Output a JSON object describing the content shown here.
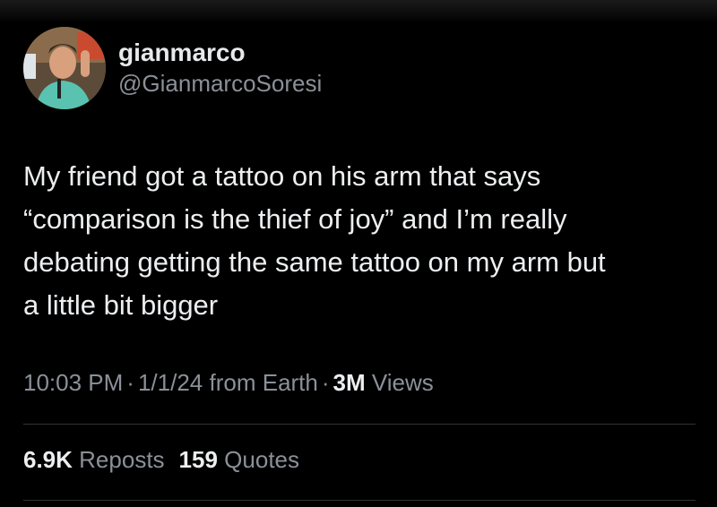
{
  "author": {
    "display_name": "gianmarco",
    "handle": "@GianmarcoSoresi",
    "avatar_icon": "profile-photo"
  },
  "tweet": {
    "text_lines": [
      "My friend got a tattoo on his arm that says",
      "“comparison is the thief of joy” and I’m really",
      "debating getting the same tattoo on my arm but",
      "a little bit bigger"
    ]
  },
  "meta": {
    "time": "10:03 PM",
    "separator": "·",
    "date": "1/1/24",
    "location": "from Earth",
    "views_count": "3M",
    "views_label": "Views"
  },
  "stats": {
    "reposts_count": "6.9K",
    "reposts_label": "Reposts",
    "quotes_count": "159",
    "quotes_label": "Quotes"
  },
  "colors": {
    "background": "#000000",
    "text": "#e7e9ea",
    "secondary_text": "#8b9098",
    "divider": "#2f3336"
  }
}
